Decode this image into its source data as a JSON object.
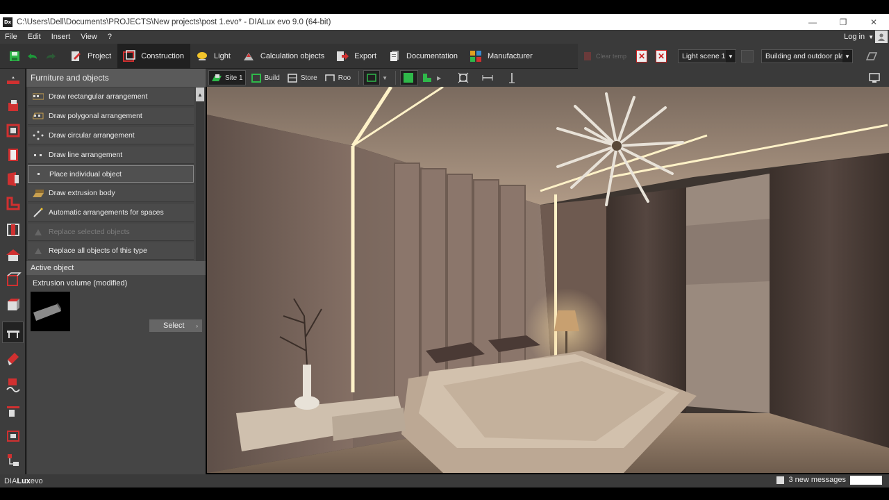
{
  "window": {
    "title": "C:\\Users\\Dell\\Documents\\PROJECTS\\New projects\\post 1.evo* - DIALux evo 9.0  (64-bit)",
    "logo_text": "Dx",
    "minimize": "—",
    "restore": "❐",
    "close": "✕"
  },
  "menu": {
    "items": [
      "File",
      "Edit",
      "Insert",
      "View",
      "?"
    ],
    "login": "Log in",
    "login_caret": "▼"
  },
  "toolbar": {
    "tabs": [
      {
        "label": "Project",
        "icon": "project-icon"
      },
      {
        "label": "Construction",
        "icon": "construction-icon"
      },
      {
        "label": "Light",
        "icon": "light-icon"
      },
      {
        "label": "Calculation objects",
        "icon": "calculation-objects-icon"
      },
      {
        "label": "Export",
        "icon": "export-icon"
      },
      {
        "label": "Documentation",
        "icon": "documentation-icon"
      },
      {
        "label": "Manufacturer",
        "icon": "manufacturer-icon"
      }
    ],
    "active_tab": "Construction",
    "disabled_btn_label": "Clear temp",
    "light_scene": "Light scene 1",
    "view_select": "Building and outdoor pla...",
    "caret": "▼"
  },
  "view_toolbar": {
    "items": [
      "Site 1",
      "Build",
      "Store",
      "Roo"
    ]
  },
  "panel": {
    "header": "Furniture and objects",
    "items": [
      {
        "label": "Draw rectangular arrangement",
        "state": "normal"
      },
      {
        "label": "Draw polygonal arrangement",
        "state": "normal"
      },
      {
        "label": "Draw circular arrangement",
        "state": "normal"
      },
      {
        "label": "Draw line arrangement",
        "state": "normal"
      },
      {
        "label": "Place individual object",
        "state": "selected"
      },
      {
        "label": "Draw extrusion body",
        "state": "normal"
      },
      {
        "label": "Automatic arrangements for spaces",
        "state": "normal"
      },
      {
        "label": "Replace selected objects",
        "state": "disabled"
      },
      {
        "label": "Replace all objects of this type",
        "state": "normal"
      }
    ],
    "active_object_header": "Active object",
    "active_object_name": "Extrusion volume (modified)",
    "select_label": "Select",
    "select_chevron": "›",
    "scroll_up": "▲"
  },
  "status": {
    "brand_prefix": "DIA",
    "brand_bold": "Lux",
    "brand_suffix": "evo",
    "messages": "3 new messages"
  },
  "colors": {
    "accent_green": "#2fb84a",
    "accent_red": "#d03030",
    "panel_bg": "#454545"
  }
}
